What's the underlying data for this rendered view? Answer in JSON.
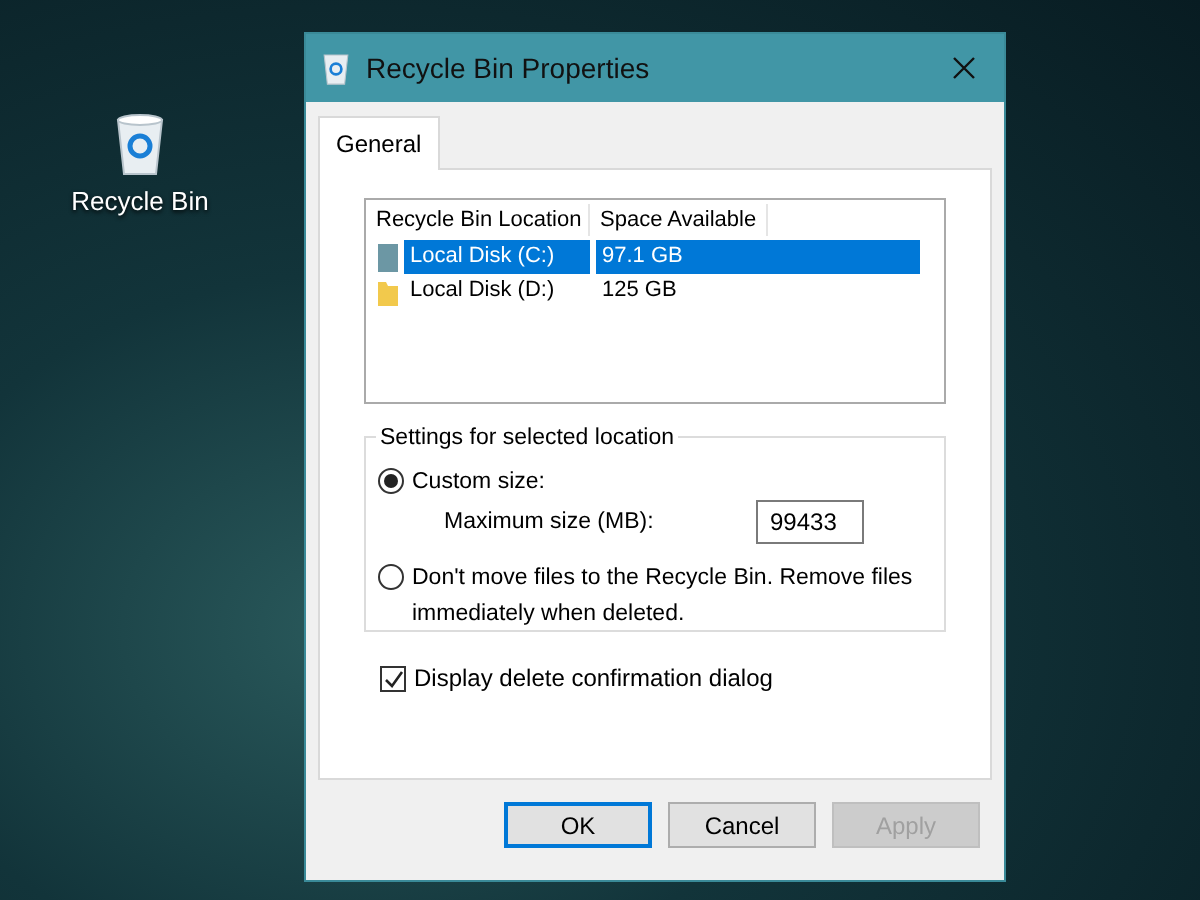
{
  "desktop_icons": [
    {
      "label": "Recycle Bin"
    }
  ],
  "window": {
    "title": "Recycle Bin Properties"
  },
  "tabs": [
    {
      "label": "General",
      "selected": true
    }
  ],
  "table": {
    "columns": [
      "Recycle Bin Location",
      "Space Available"
    ],
    "rows": [
      {
        "location": "Local Disk (C:)",
        "space": "97.1 GB",
        "selected": true,
        "kind": "system"
      },
      {
        "location": "Local Disk (D:)",
        "space": "125 GB",
        "selected": false,
        "kind": "folder"
      }
    ]
  },
  "settings": {
    "title": "Settings for selected location",
    "options": [
      {
        "label": "Custom size:",
        "selected": true,
        "field_label": "Maximum size (MB):",
        "field_value": "99433"
      },
      {
        "label": "Don't move files to the Recycle Bin. Remove files immediately when deleted.",
        "selected": false
      }
    ]
  },
  "confirm_checkbox": {
    "label": "Display delete confirmation dialog",
    "checked": true
  },
  "buttons": [
    {
      "label": "OK",
      "default": true,
      "disabled": false
    },
    {
      "label": "Cancel",
      "default": false,
      "disabled": false
    },
    {
      "label": "Apply",
      "default": false,
      "disabled": true
    }
  ]
}
